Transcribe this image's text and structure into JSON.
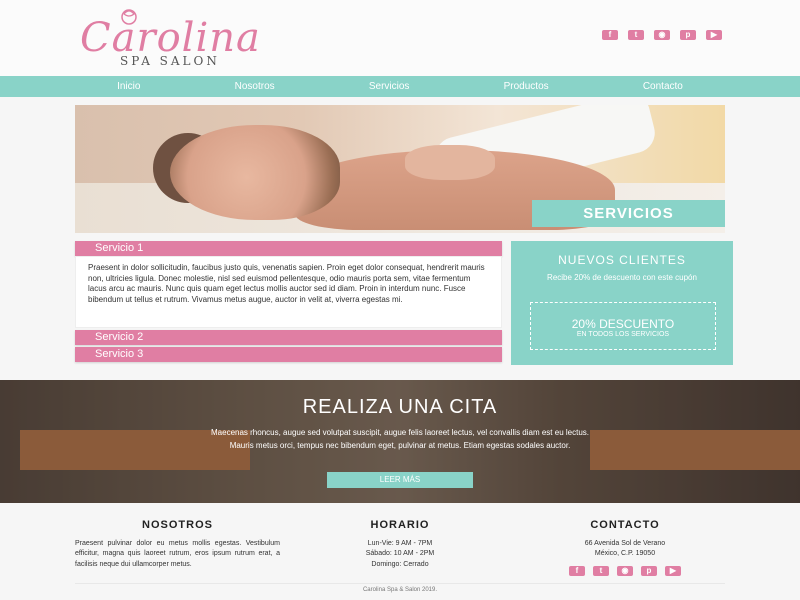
{
  "brand": {
    "name": "Carolina",
    "tagline": "SPA SALON"
  },
  "nav": [
    "Inicio",
    "Nosotros",
    "Servicios",
    "Productos",
    "Contacto"
  ],
  "social_top": [
    {
      "icon": "facebook-icon",
      "glyph": "f"
    },
    {
      "icon": "twitter-icon",
      "glyph": "t"
    },
    {
      "icon": "instagram-icon",
      "glyph": "◉"
    },
    {
      "icon": "pinterest-icon",
      "glyph": "p"
    },
    {
      "icon": "youtube-icon",
      "glyph": "▶"
    }
  ],
  "hero": {
    "label": "SERVICIOS"
  },
  "services": {
    "items": [
      "Servicio 1",
      "Servicio 2",
      "Servicio 3"
    ],
    "body": "Praesent in dolor sollicitudin, faucibus justo quis, venenatis sapien. Proin eget dolor consequat, hendrerit mauris non, ultricies ligula. Donec molestie, nisl sed euismod pellentesque, odio mauris porta sem, vitae fermentum lacus arcu ac mauris. Nunc quis quam eget lectus mollis auctor sed id diam. Proin in interdum nunc. Fusce bibendum ut tellus et rutrum. Vivamus metus augue, auctor in velit at, viverra egestas mi."
  },
  "promo": {
    "title": "NUEVOS CLIENTES",
    "subtitle": "Recibe 20% de descuento con este cupón",
    "discount": "20% DESCUENTO",
    "note": "EN TODOS LOS SERVICIOS"
  },
  "cita": {
    "title": "REALIZA UNA CITA",
    "text": "Maecenas rhoncus, augue sed volutpat suscipit, augue felis laoreet lectus, vel convallis diam est eu lectus. Mauris metus orci, tempus nec bibendum eget, pulvinar at metus. Etiam egestas sodales auctor.",
    "button": "LEER MÁS"
  },
  "footer": {
    "about": {
      "title": "NOSOTROS",
      "text": "Praesent pulvinar dolor eu metus mollis egestas. Vestibulum efficitur, magna quis laoreet rutrum, eros ipsum rutrum erat, a facilisis neque dui ullamcorper metus."
    },
    "hours": {
      "title": "HORARIO",
      "lines": [
        "Lun-Vie: 9 AM - 7PM",
        "Sábado: 10 AM - 2PM",
        "Domingo: Cerrado"
      ]
    },
    "contact": {
      "title": "CONTACTO",
      "lines": [
        "66 Avenida Sol de Verano",
        "México, C.P. 19050"
      ]
    },
    "copyright": "Carolina Spa & Salon 2019."
  },
  "colors": {
    "pink": "#e07ea3",
    "teal": "#89d3c8"
  }
}
